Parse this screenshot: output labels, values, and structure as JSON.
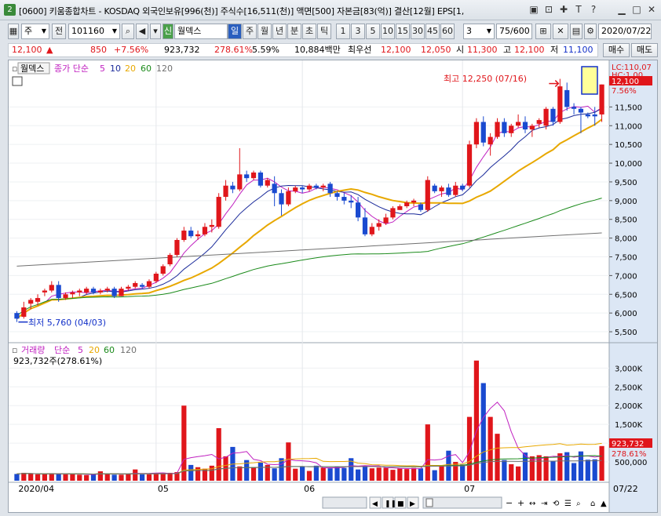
{
  "window": {
    "num": "2",
    "title": "[0600] 키움종합차트 - KOSDAQ 외국인보유[996(천)] 주식수[16,511(천)] 액면[500] 자본금[83(억)] 결산[12월] EPS[1,",
    "icons": [
      "restore-icon",
      "link-icon",
      "pin-icon",
      "text-icon",
      "help-icon",
      "minimize-icon",
      "maximize-icon",
      "close-icon"
    ]
  },
  "toolbar": {
    "period": "주",
    "prev": "전",
    "code": "101160",
    "sin": "신",
    "name": "월덱스",
    "tabs": [
      "일",
      "주",
      "월",
      "년",
      "분",
      "초",
      "틱"
    ],
    "numbers": [
      "1",
      "3",
      "5",
      "10",
      "15",
      "30",
      "45",
      "60"
    ],
    "combo": "3",
    "count": "75/600",
    "date": "2020/07/22"
  },
  "price": {
    "current": "12,100",
    "arrow": "▲",
    "change": "850",
    "change_pct": "+7.56%",
    "volume": "923,732",
    "vol_ratio": "278.61%",
    "turnover": "5.59%",
    "amount": "10,884백만",
    "priority_label": "최우선",
    "ask": "12,100",
    "bid": "12,050",
    "open_label": "시",
    "open": "11,300",
    "high_label": "고",
    "high": "12,100",
    "low_label": "저",
    "low": "11,100",
    "buy": "매수",
    "sell": "매도"
  },
  "main_legend": {
    "name": "월덱스",
    "ma_label": "종가 단순",
    "periods": [
      "5",
      "10",
      "20",
      "60",
      "120"
    ],
    "colors": [
      "#c020c0",
      "#1a2a9a",
      "#e8a800",
      "#1a8a1a",
      "#707070"
    ]
  },
  "annotations": {
    "high": "최고 12,250 (07/16)",
    "low": "최저 5,760 (04/03)",
    "lc": "LC:110,07",
    "hc": "HC:1,00",
    "price_tag": "12,100",
    "pct_tag": "7.56%"
  },
  "y_ticks": [
    "11,500",
    "11,000",
    "10,500",
    "10,000",
    "9,500",
    "9,000",
    "8,500",
    "8,000",
    "7,500",
    "7,000",
    "6,500",
    "6,000",
    "5,500"
  ],
  "vol_legend": {
    "name": "거래량",
    "ma_label": "단순",
    "periods": [
      "5",
      "20",
      "60",
      "120"
    ],
    "info": "923,732주(278.61%)"
  },
  "vol_ticks": [
    "3,000K",
    "2,500K",
    "2,000K",
    "1,500K",
    "1,000K",
    "500,000"
  ],
  "vol_tags": {
    "vol": "923,732",
    "pct": "278.61%"
  },
  "x_labels": [
    "2020/04",
    "05",
    "06",
    "07",
    "07/22"
  ],
  "chart_data": {
    "type": "candlestick",
    "ylim": [
      5250,
      12450
    ],
    "candles": [
      [
        6000,
        6050,
        5760,
        5850
      ],
      [
        5900,
        6300,
        5850,
        6150
      ],
      [
        6250,
        6400,
        6100,
        6350
      ],
      [
        6300,
        6500,
        6200,
        6400
      ],
      [
        6550,
        6650,
        6450,
        6600
      ],
      [
        6600,
        6850,
        6550,
        6750
      ],
      [
        6750,
        6850,
        6300,
        6400
      ],
      [
        6400,
        6550,
        6350,
        6500
      ],
      [
        6500,
        6600,
        6400,
        6550
      ],
      [
        6550,
        6650,
        6450,
        6600
      ],
      [
        6550,
        6700,
        6500,
        6650
      ],
      [
        6650,
        6700,
        6500,
        6550
      ],
      [
        6550,
        6650,
        6500,
        6600
      ],
      [
        6600,
        6700,
        6550,
        6650
      ],
      [
        6650,
        6700,
        6400,
        6450
      ],
      [
        6450,
        6700,
        6450,
        6650
      ],
      [
        6650,
        6750,
        6600,
        6700
      ],
      [
        6700,
        6850,
        6650,
        6800
      ],
      [
        6750,
        6800,
        6650,
        6700
      ],
      [
        6700,
        6900,
        6650,
        6850
      ],
      [
        6850,
        7100,
        6800,
        7050
      ],
      [
        7050,
        7300,
        7000,
        7250
      ],
      [
        7300,
        7600,
        7250,
        7550
      ],
      [
        7550,
        8000,
        7500,
        7950
      ],
      [
        7950,
        8300,
        7900,
        8200
      ],
      [
        8200,
        8300,
        8000,
        8050
      ],
      [
        8050,
        8200,
        7950,
        8100
      ],
      [
        8100,
        8400,
        8050,
        8300
      ],
      [
        8300,
        8500,
        8150,
        8350
      ],
      [
        8300,
        9200,
        8250,
        9100
      ],
      [
        9100,
        9550,
        9000,
        9400
      ],
      [
        9400,
        9500,
        9200,
        9300
      ],
      [
        9300,
        10400,
        9250,
        9700
      ],
      [
        9700,
        9800,
        9500,
        9600
      ],
      [
        9600,
        9800,
        9550,
        9750
      ],
      [
        9750,
        9800,
        9350,
        9400
      ],
      [
        9400,
        9600,
        9350,
        9550
      ],
      [
        9450,
        9650,
        8850,
        9200
      ],
      [
        9200,
        9300,
        8600,
        8900
      ],
      [
        8900,
        9350,
        8850,
        9250
      ],
      [
        9250,
        9400,
        9200,
        9350
      ],
      [
        9350,
        9400,
        9200,
        9300
      ],
      [
        9300,
        9450,
        9250,
        9400
      ],
      [
        9400,
        9450,
        9300,
        9350
      ],
      [
        9350,
        9450,
        9250,
        9400
      ],
      [
        9450,
        9500,
        9100,
        9200
      ],
      [
        9200,
        9250,
        9000,
        9100
      ],
      [
        9100,
        9200,
        8900,
        9000
      ],
      [
        9000,
        9150,
        8800,
        8950
      ],
      [
        8950,
        9100,
        8450,
        8550
      ],
      [
        8550,
        8800,
        8050,
        8100
      ],
      [
        8100,
        8400,
        8050,
        8300
      ],
      [
        8300,
        8500,
        8200,
        8400
      ],
      [
        8400,
        8650,
        8350,
        8550
      ],
      [
        8550,
        8850,
        8500,
        8800
      ],
      [
        8750,
        8900,
        8750,
        8850
      ],
      [
        8850,
        9000,
        8800,
        8950
      ],
      [
        8950,
        9050,
        8850,
        9000
      ],
      [
        8900,
        8950,
        8700,
        8750
      ],
      [
        8750,
        9650,
        8700,
        9550
      ],
      [
        9400,
        9450,
        9200,
        9250
      ],
      [
        9250,
        9400,
        9100,
        9350
      ],
      [
        9350,
        9450,
        9100,
        9150
      ],
      [
        9150,
        9500,
        9100,
        9400
      ],
      [
        9400,
        9450,
        9250,
        9300
      ],
      [
        9400,
        10600,
        9350,
        10500
      ],
      [
        10500,
        11200,
        10400,
        11100
      ],
      [
        11100,
        11250,
        10450,
        10550
      ],
      [
        10500,
        10800,
        10200,
        10700
      ],
      [
        10700,
        11200,
        10650,
        11100
      ],
      [
        11100,
        11200,
        10700,
        10800
      ],
      [
        10800,
        11050,
        10700,
        11000
      ],
      [
        11000,
        11300,
        10950,
        11100
      ],
      [
        11100,
        11250,
        10800,
        10900
      ],
      [
        10900,
        11050,
        10700,
        11000
      ],
      [
        11050,
        11200,
        10950,
        11150
      ],
      [
        11000,
        11500,
        10900,
        11450
      ],
      [
        11450,
        11500,
        11000,
        11100
      ],
      [
        11100,
        12250,
        11050,
        12050
      ],
      [
        11950,
        12150,
        11400,
        11500
      ],
      [
        11500,
        11600,
        11300,
        11450
      ],
      [
        11450,
        11500,
        10800,
        11350
      ],
      [
        11300,
        11350,
        11200,
        11250
      ],
      [
        11300,
        11500,
        11000,
        11250
      ],
      [
        11300,
        12100,
        11100,
        12100
      ]
    ],
    "volumes": [
      180,
      210,
      180,
      170,
      180,
      200,
      190,
      170,
      180,
      160,
      150,
      170,
      250,
      180,
      160,
      160,
      180,
      300,
      170,
      170,
      190,
      210,
      210,
      230,
      2000,
      420,
      360,
      320,
      400,
      1400,
      650,
      900,
      380,
      550,
      360,
      480,
      420,
      330,
      600,
      1020,
      320,
      380,
      260,
      400,
      350,
      330,
      370,
      340,
      600,
      300,
      400,
      330,
      350,
      340,
      290,
      330,
      310,
      340,
      330,
      1500,
      280,
      400,
      800,
      500,
      430,
      1700,
      3200,
      2600,
      1700,
      1250,
      550,
      440,
      380,
      750,
      650,
      680,
      650,
      520,
      730,
      760,
      470,
      780,
      560,
      570,
      923
    ]
  }
}
